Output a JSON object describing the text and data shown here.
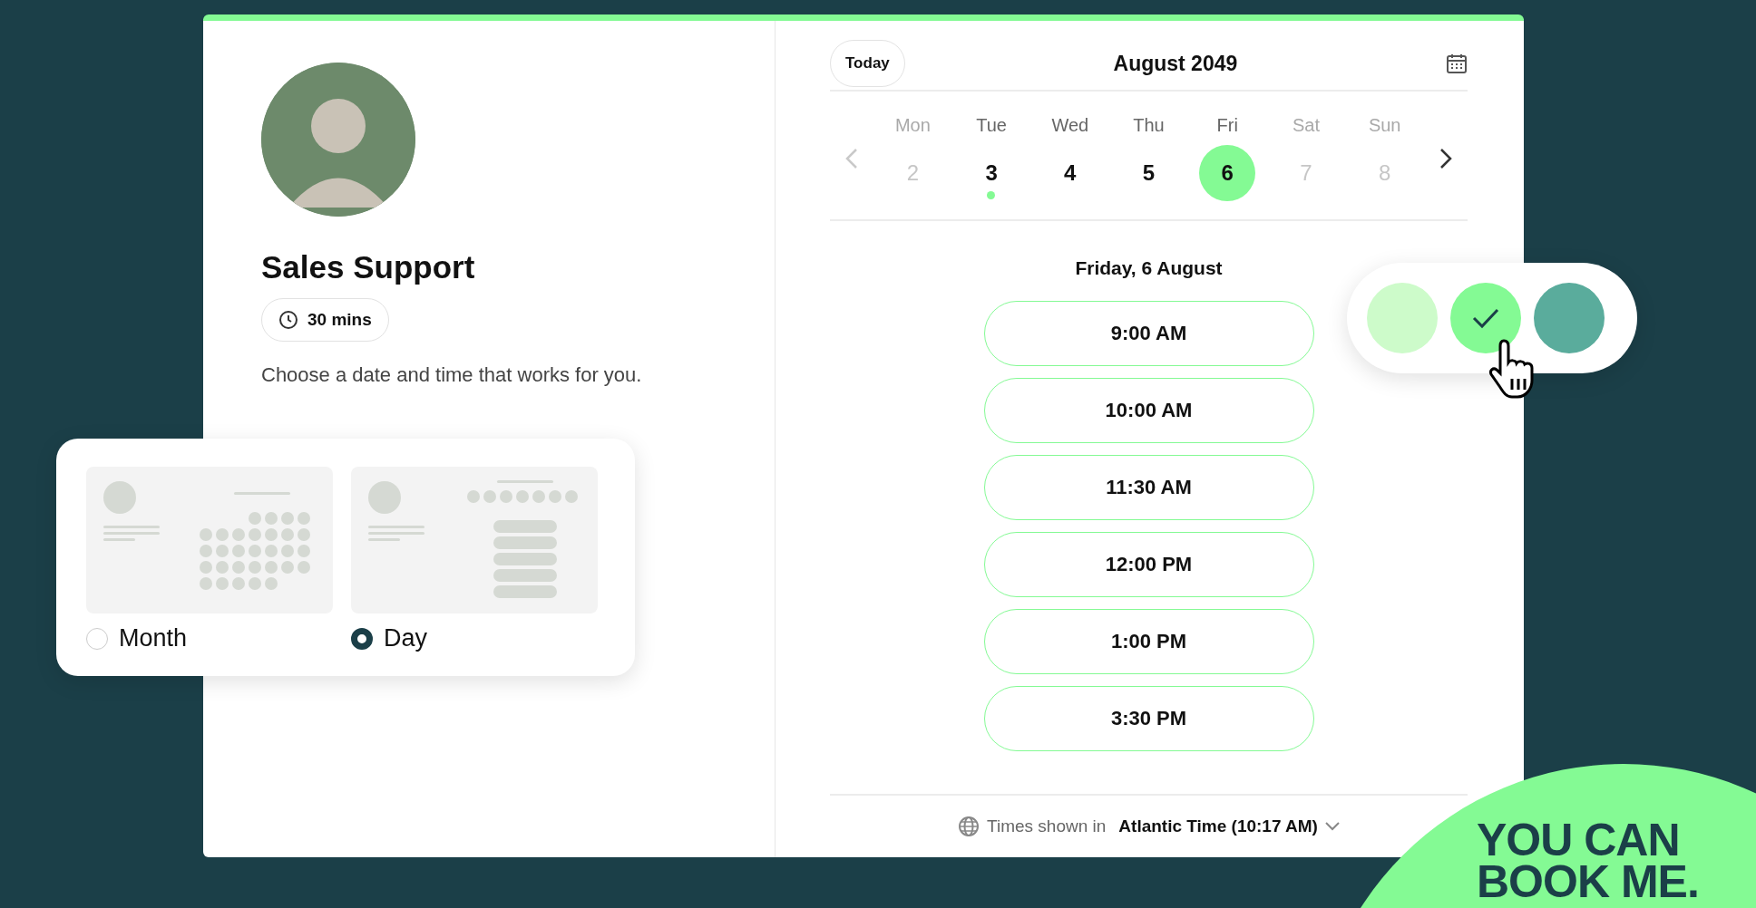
{
  "profile": {
    "name": "Sales Support",
    "duration": "30 mins",
    "prompt": "Choose a date and time that works for you."
  },
  "layout_picker": {
    "options": [
      {
        "label": "Month",
        "kind": "month",
        "selected": false
      },
      {
        "label": "Day",
        "kind": "day",
        "selected": true
      }
    ]
  },
  "calendar": {
    "today_button": "Today",
    "title": "August 2049",
    "prev_disabled": true,
    "next_disabled": false,
    "days": [
      {
        "weekday": "Mon",
        "date": "2",
        "available": false,
        "selected": false,
        "today": false
      },
      {
        "weekday": "Tue",
        "date": "3",
        "available": true,
        "selected": false,
        "today": true
      },
      {
        "weekday": "Wed",
        "date": "4",
        "available": true,
        "selected": false,
        "today": false
      },
      {
        "weekday": "Thu",
        "date": "5",
        "available": true,
        "selected": false,
        "today": false
      },
      {
        "weekday": "Fri",
        "date": "6",
        "available": true,
        "selected": true,
        "today": false
      },
      {
        "weekday": "Sat",
        "date": "7",
        "available": false,
        "selected": false,
        "today": false
      },
      {
        "weekday": "Sun",
        "date": "8",
        "available": false,
        "selected": false,
        "today": false
      }
    ],
    "day_heading": "Friday, 6 August",
    "slots": [
      "9:00 AM",
      "10:00 AM",
      "11:30 AM",
      "12:00 PM",
      "1:00 PM",
      "3:30 PM"
    ],
    "timezone": {
      "label": "Times shown in",
      "value": "Atlantic Time (10:17 AM)"
    }
  },
  "color_picker": {
    "swatches": [
      {
        "color": "#cdfbca",
        "selected": false
      },
      {
        "color": "#84fa94",
        "selected": true
      },
      {
        "color": "#5aac9c",
        "selected": false
      }
    ]
  },
  "brand": {
    "lines": [
      "YOU CAN",
      "BOOK ME."
    ]
  }
}
